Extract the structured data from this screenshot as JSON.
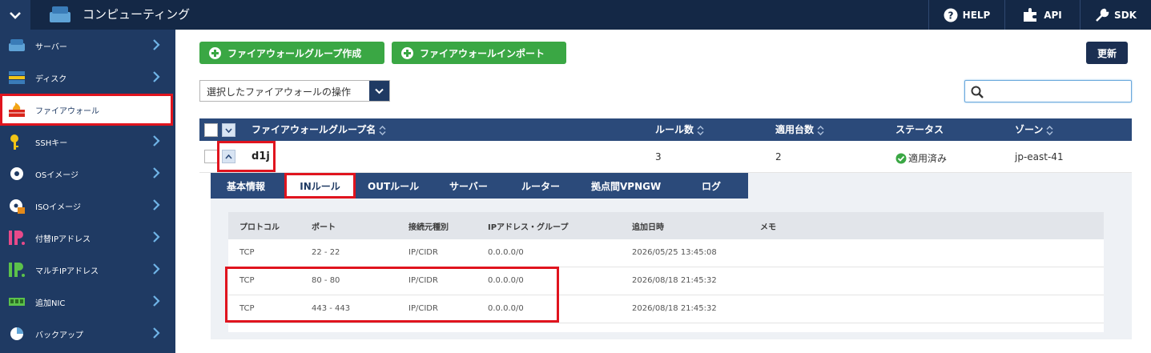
{
  "header": {
    "title": "コンピューティング",
    "help": "HELP",
    "api": "API",
    "sdk": "SDK"
  },
  "sidebar": {
    "items": [
      {
        "label": "サーバー",
        "icon": "server-icon"
      },
      {
        "label": "ディスク",
        "icon": "disk-icon"
      },
      {
        "label": "ファイアウォール",
        "icon": "firewall-icon",
        "active": true
      },
      {
        "label": "SSHキー",
        "icon": "key-icon"
      },
      {
        "label": "OSイメージ",
        "icon": "disc-icon"
      },
      {
        "label": "ISOイメージ",
        "icon": "iso-icon"
      },
      {
        "label": "付替IPアドレス",
        "icon": "ip-icon"
      },
      {
        "label": "マルチIPアドレス",
        "icon": "multi-ip-icon"
      },
      {
        "label": "追加NIC",
        "icon": "nic-icon"
      },
      {
        "label": "バックアップ",
        "icon": "backup-icon"
      }
    ]
  },
  "toolbar": {
    "create_label": "ファイアウォールグループ作成",
    "import_label": "ファイアウォールインポート",
    "refresh_label": "更新",
    "select_label": "選択したファイアウォールの操作"
  },
  "table": {
    "headers": {
      "name": "ファイアウォールグループ名",
      "rules": "ルール数",
      "applied": "適用台数",
      "status": "ステータス",
      "zone": "ゾーン"
    },
    "row": {
      "name": "d1j",
      "rules": "3",
      "applied": "2",
      "status": "適用済み",
      "zone": "jp-east-41"
    }
  },
  "tabs": [
    "基本情報",
    "INルール",
    "OUTルール",
    "サーバー",
    "ルーター",
    "拠点間VPNGW",
    "ログ"
  ],
  "rules": {
    "headers": {
      "protocol": "プロトコル",
      "port": "ポート",
      "source_type": "接続元種別",
      "ip": "IPアドレス・グループ",
      "added": "追加日時",
      "memo": "メモ"
    },
    "rows": [
      {
        "protocol": "TCP",
        "port": "22 - 22",
        "source_type": "IP/CIDR",
        "ip": "0.0.0.0/0",
        "added": "2026/05/25 13:45:08",
        "memo": ""
      },
      {
        "protocol": "TCP",
        "port": "80 - 80",
        "source_type": "IP/CIDR",
        "ip": "0.0.0.0/0",
        "added": "2026/08/18 21:45:32",
        "memo": ""
      },
      {
        "protocol": "TCP",
        "port": "443 - 443",
        "source_type": "IP/CIDR",
        "ip": "0.0.0.0/0",
        "added": "2026/08/18 21:45:32",
        "memo": ""
      }
    ]
  },
  "colors": {
    "navy": "#142846",
    "sidebar": "#1f3a63",
    "accent_green": "#3aa744",
    "highlight_red": "#e0141e"
  }
}
